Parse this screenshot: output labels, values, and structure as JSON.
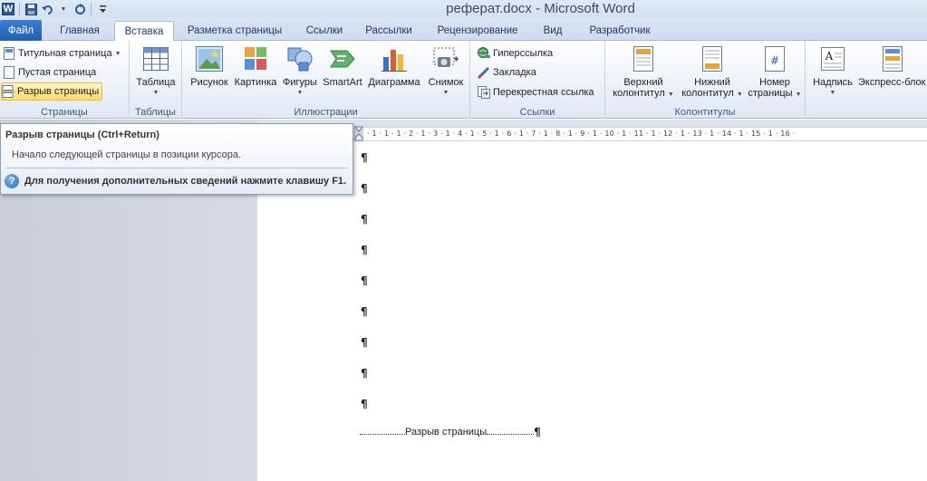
{
  "window": {
    "title": "реферат.docx - Microsoft Word",
    "app_logo": "W"
  },
  "qat": {
    "save_icon": "save-icon",
    "undo_icon": "undo-icon",
    "redo_icon": "repeat-icon",
    "customize_icon": "customize-qat-icon"
  },
  "tabs": [
    {
      "label": "Файл"
    },
    {
      "label": "Главная"
    },
    {
      "label": "Вставка"
    },
    {
      "label": "Разметка страницы"
    },
    {
      "label": "Ссылки"
    },
    {
      "label": "Рассылки"
    },
    {
      "label": "Рецензирование"
    },
    {
      "label": "Вид"
    },
    {
      "label": "Разработчик"
    }
  ],
  "ribbon": {
    "pages": {
      "label": "Страницы",
      "cover_page": "Титульная страница",
      "blank_page": "Пустая страница",
      "page_break": "Разрыв страницы"
    },
    "tables": {
      "label": "Таблицы",
      "table": "Таблица"
    },
    "illustrations": {
      "label": "Иллюстрации",
      "picture": "Рисунок",
      "clipart": "Картинка",
      "shapes": "Фигуры",
      "smartart": "SmartArt",
      "chart": "Диаграмма",
      "screenshot": "Снимок"
    },
    "links": {
      "label": "Ссылки",
      "hyperlink": "Гиперссылка",
      "bookmark": "Закладка",
      "cross_reference": "Перекрестная ссылка"
    },
    "header_footer": {
      "label": "Колонтитулы",
      "header_line1": "Верхний",
      "header_line2": "колонтитул",
      "footer_line1": "Нижний",
      "footer_line2": "колонтитул",
      "page_number_line1": "Номер",
      "page_number_line2": "страницы"
    },
    "text": {
      "textbox": "Надпись",
      "quickparts": "Экспресс-блок"
    }
  },
  "ruler": {
    "ticks": "· 1 · 1 · 1 · 2 · 1 · 3 · 1 · 4 · 1 · 5 · 1 · 6 · 1 · 7 · 1 · 8 · 1 · 9 · 1 · 10 · 1 · 11 · 1 · 12 · 1 · 13 · 1 · 14 · 1 · 15 · 1 · 16 ·"
  },
  "tooltip": {
    "title": "Разрыв страницы (Ctrl+Return)",
    "description": "Начало следующей страницы в позиции курсора.",
    "help": "Для получения дополнительных сведений нажмите клавишу F1."
  },
  "document": {
    "pilcrow": "¶",
    "page_break_label": "Разрыв страницы"
  },
  "colors": {
    "file_tab": "#2b6cc4",
    "highlight": "#ffd96b",
    "ribbon_border": "#a3bad9"
  }
}
